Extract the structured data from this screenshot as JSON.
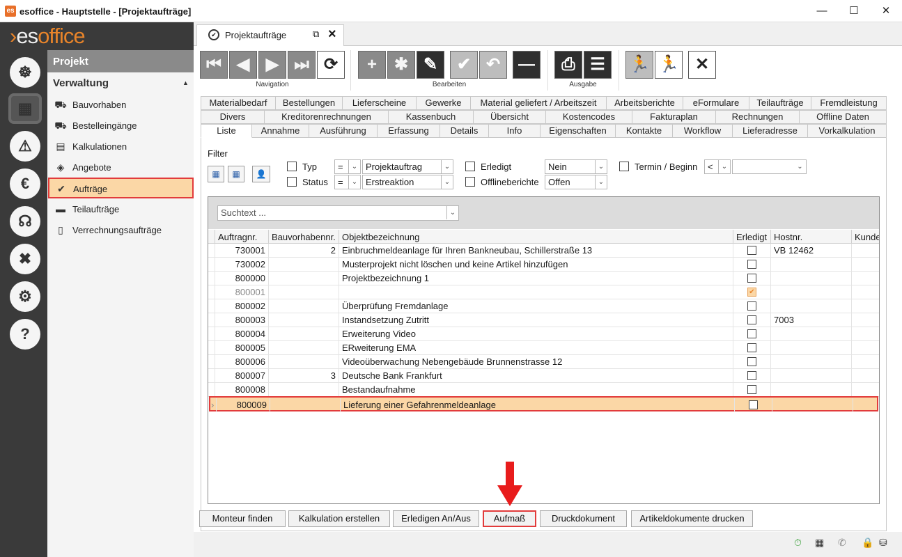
{
  "window": {
    "title": "esoffice - Hauptstelle - [Projektaufträge]",
    "minimize": "—",
    "maximize": "☐",
    "close": "✕"
  },
  "brand": {
    "logo_prefix": "es",
    "logo_suffix": "office"
  },
  "rail": {
    "icons": [
      "ship-wheel-icon",
      "dashboard-icon",
      "alarm-light-icon",
      "money-icon",
      "headset-icon",
      "tools-icon",
      "settings-icon",
      "help-icon"
    ]
  },
  "nav": {
    "header": "Projekt",
    "section": "Verwaltung",
    "items": [
      {
        "label": "Bauvorhaben",
        "icon": "truck-icon"
      },
      {
        "label": "Bestelleingänge",
        "icon": "truck-icon"
      },
      {
        "label": "Kalkulationen",
        "icon": "calculator-icon"
      },
      {
        "label": "Angebote",
        "icon": "price-tag-icon"
      },
      {
        "label": "Aufträge",
        "icon": "check-circle-icon"
      },
      {
        "label": "Teilaufträge",
        "icon": "card-icon"
      },
      {
        "label": "Verrechnungsaufträge",
        "icon": "document-icon"
      }
    ]
  },
  "doc_tab": {
    "label": "Projektaufträge"
  },
  "toolbar": {
    "groups": {
      "navigation": "Navigation",
      "edit": "Bearbeiten",
      "output": "Ausgabe"
    }
  },
  "tabs": {
    "row1": [
      "Materialbedarf",
      "Bestellungen",
      "Lieferscheine",
      "Gewerke",
      "Material geliefert / Arbeitszeit",
      "Arbeitsberichte",
      "eFormulare",
      "Teilaufträge",
      "Fremdleistung"
    ],
    "row2": [
      "Divers",
      "Kreditorenrechnungen",
      "Kassenbuch",
      "Übersicht",
      "Kostencodes",
      "Fakturaplan",
      "Rechnungen",
      "Offline Daten"
    ],
    "row3": [
      "Liste",
      "Annahme",
      "Ausführung",
      "Erfassung",
      "Details",
      "Info",
      "Eigenschaften",
      "Kontakte",
      "Workflow",
      "Lieferadresse",
      "Vorkalkulation"
    ]
  },
  "filter": {
    "title": "Filter",
    "typ_label": "Typ",
    "typ_op": "=",
    "typ_value": "Projektauftrag",
    "status_label": "Status",
    "status_op": "=",
    "status_value": "Erstreaktion",
    "erledigt_label": "Erledigt",
    "erledigt_value": "Nein",
    "offline_label": "Offlineberichte",
    "offline_value": "Offen",
    "termin_label": "Termin / Beginn",
    "termin_op": "<",
    "termin_value": ""
  },
  "grid": {
    "search_placeholder": "Suchtext ...",
    "columns": [
      "Auftragnr.",
      "Bauvorhabennr.",
      "Objektbezeichnung",
      "Erledigt",
      "Hostnr.",
      "Kunde"
    ],
    "rows": [
      {
        "nr": "730001",
        "bv": "2",
        "obj": "Einbruchmeldeanlage für Ihren Bankneubau, Schillerstraße 13",
        "done": false,
        "host": "VB 12462"
      },
      {
        "nr": "730002",
        "bv": "",
        "obj": "Musterprojekt nicht löschen und keine Artikel hinzufügen",
        "done": false,
        "host": ""
      },
      {
        "nr": "800000",
        "bv": "",
        "obj": "Projektbezeichnung 1",
        "done": false,
        "host": ""
      },
      {
        "nr": "800001",
        "bv": "",
        "obj": "",
        "done": true,
        "host": ""
      },
      {
        "nr": "800002",
        "bv": "",
        "obj": "Überprüfung Fremdanlage",
        "done": false,
        "host": ""
      },
      {
        "nr": "800003",
        "bv": "",
        "obj": "Instandsetzung Zutritt",
        "done": false,
        "host": "7003"
      },
      {
        "nr": "800004",
        "bv": "",
        "obj": "Erweiterung Video",
        "done": false,
        "host": ""
      },
      {
        "nr": "800005",
        "bv": "",
        "obj": "ERweiterung EMA",
        "done": false,
        "host": ""
      },
      {
        "nr": "800006",
        "bv": "",
        "obj": "Videoüberwachung Nebengebäude Brunnenstrasse 12",
        "done": false,
        "host": ""
      },
      {
        "nr": "800007",
        "bv": "3",
        "obj": "Deutsche Bank Frankfurt",
        "done": false,
        "host": ""
      },
      {
        "nr": "800008",
        "bv": "",
        "obj": "Bestandaufnahme",
        "done": false,
        "host": ""
      },
      {
        "nr": "800009",
        "bv": "",
        "obj": "Lieferung einer Gefahrenmeldeanlage",
        "done": false,
        "host": ""
      }
    ]
  },
  "buttons": [
    "Monteur finden",
    "Kalkulation erstellen",
    "Erledigen An/Aus",
    "Aufmaß",
    "Druckdokument",
    "Artikeldokumente drucken"
  ],
  "colors": {
    "accent": "#e8842a",
    "highlight": "#e23b3b",
    "selection": "#fbd7a6"
  }
}
